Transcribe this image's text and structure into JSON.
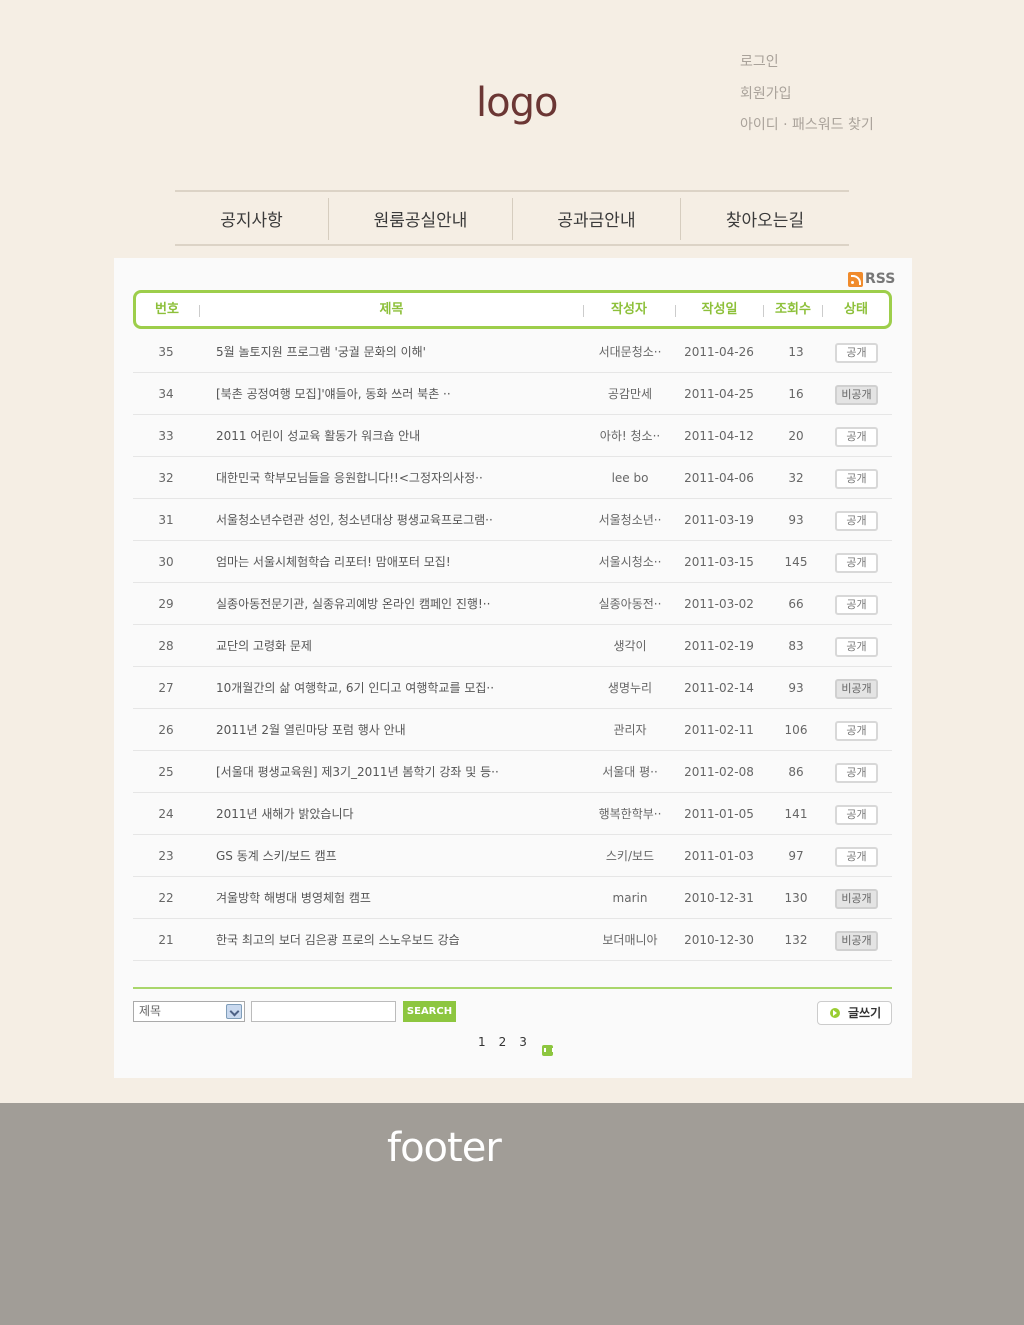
{
  "header": {
    "logo": "logo",
    "util": [
      "로그인",
      "회원가입",
      "아이디 · 패스워드 찾기"
    ]
  },
  "nav": [
    "공지사항",
    "원룸공실안내",
    "공과금안내",
    "찾아오는길"
  ],
  "board": {
    "rss_label": "RSS",
    "columns": [
      "번호",
      "제목",
      "작성자",
      "작성일",
      "조회수",
      "상태"
    ],
    "rows": [
      {
        "no": "35",
        "title": "5월 놀토지원 프로그램 '궁궐 문화의 이해'",
        "author": "서대문청소··",
        "date": "2011-04-26",
        "views": "13",
        "status": "공개"
      },
      {
        "no": "34",
        "title": "[북촌 공정여행 모집]'얘들아, 동화 쓰러 북촌 ··",
        "author": "공감만세",
        "date": "2011-04-25",
        "views": "16",
        "status": "비공개"
      },
      {
        "no": "33",
        "title": "2011 어린이 성교육 활동가 워크숍 안내",
        "author": "아하! 청소··",
        "date": "2011-04-12",
        "views": "20",
        "status": "공개"
      },
      {
        "no": "32",
        "title": "대한민국 학부모님들을 응원합니다!!<그정자의사정··",
        "author": "lee bo",
        "date": "2011-04-06",
        "views": "32",
        "status": "공개"
      },
      {
        "no": "31",
        "title": "서울청소년수련관 성인, 청소년대상 평생교육프로그램··",
        "author": "서울청소년··",
        "date": "2011-03-19",
        "views": "93",
        "status": "공개"
      },
      {
        "no": "30",
        "title": "엄마는 서울시체험학습 리포터! 맘애포터 모집!",
        "author": "서울시청소··",
        "date": "2011-03-15",
        "views": "145",
        "status": "공개"
      },
      {
        "no": "29",
        "title": "실종아동전문기관, 실종유괴예방 온라인 캠페인 진행!··",
        "author": "실종아동전··",
        "date": "2011-03-02",
        "views": "66",
        "status": "공개"
      },
      {
        "no": "28",
        "title": "교단의 고령화 문제",
        "author": "생각이",
        "date": "2011-02-19",
        "views": "83",
        "status": "공개"
      },
      {
        "no": "27",
        "title": "10개월간의 삶 여행학교, 6기 인디고 여행학교를 모집··",
        "author": "생명누리",
        "date": "2011-02-14",
        "views": "93",
        "status": "비공개"
      },
      {
        "no": "26",
        "title": "2011년 2월 열린마당 포럼 행사 안내",
        "author": "관리자",
        "date": "2011-02-11",
        "views": "106",
        "status": "공개"
      },
      {
        "no": "25",
        "title": "[서울대 평생교육원] 제3기_2011년 봄학기 강좌 및 등··",
        "author": "서울대 평··",
        "date": "2011-02-08",
        "views": "86",
        "status": "공개"
      },
      {
        "no": "24",
        "title": "2011년 새해가 밝았습니다",
        "author": "행복한학부··",
        "date": "2011-01-05",
        "views": "141",
        "status": "공개"
      },
      {
        "no": "23",
        "title": "GS 동계 스키/보드 캠프",
        "author": "스키/보드",
        "date": "2011-01-03",
        "views": "97",
        "status": "공개"
      },
      {
        "no": "22",
        "title": "겨울방학 해병대 병영체험 캠프",
        "author": "marin",
        "date": "2010-12-31",
        "views": "130",
        "status": "비공개"
      },
      {
        "no": "21",
        "title": "한국 최고의 보더 김은광 프로의 스노우보드 강습",
        "author": "보더매니아",
        "date": "2010-12-30",
        "views": "132",
        "status": "비공개"
      }
    ]
  },
  "search": {
    "select_value": "제목",
    "input_value": "",
    "button_label": "SEARCH"
  },
  "write_label": "글쓰기",
  "pagination": [
    "1",
    "2",
    "3"
  ],
  "footer": {
    "text": "footer"
  },
  "colors": {
    "accent_green": "#8dc63f",
    "logo": "#6b3634",
    "footer_bg": "#a19d97",
    "page_bg": "#f5eee4"
  }
}
